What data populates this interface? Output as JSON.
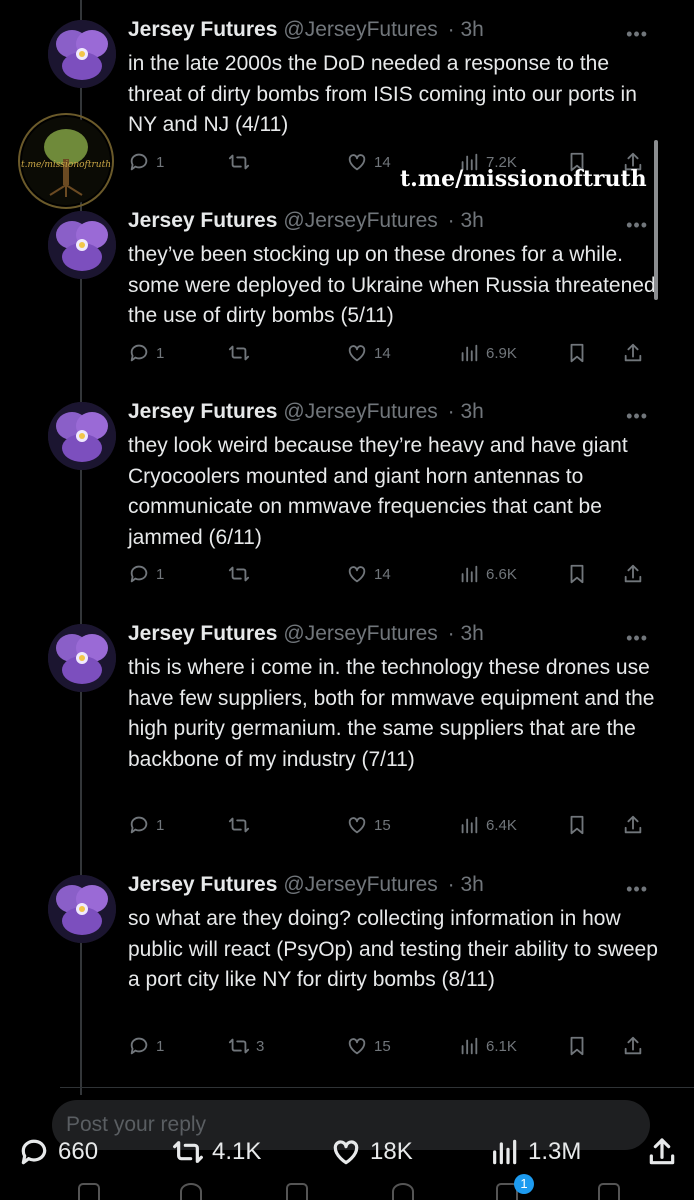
{
  "author": {
    "name": "Jersey Futures",
    "handle": "@JerseyFutures",
    "time": "· 3h"
  },
  "more_label": "•••",
  "tweets": [
    {
      "text": "in the late 2000s the DoD needed a response to the threat of dirty bombs from ISIS coming into our ports in NY and NJ (4/11)",
      "replies": "1",
      "retweets": "",
      "likes": "14",
      "views": "7.2K"
    },
    {
      "text": "they’ve been stocking up on these drones for a while. some were deployed to Ukraine when Russia threatened the use of dirty bombs (5/11)",
      "replies": "1",
      "retweets": "",
      "likes": "14",
      "views": "6.9K"
    },
    {
      "text": "they look weird because they’re heavy and have giant Cryocoolers mounted and giant horn antennas to communicate on mmwave frequencies that cant be jammed (6/11)",
      "replies": "1",
      "retweets": "",
      "likes": "14",
      "views": "6.6K"
    },
    {
      "text": "this is where i come in. the technology these drones use have few suppliers, both for mmwave equipment and the high purity germanium. the same suppliers that are the backbone of my industry (7/11)",
      "replies": "1",
      "retweets": "",
      "likes": "15",
      "views": "6.4K"
    },
    {
      "text": "so what are they doing? collecting information in how public will react (PsyOp) and testing their ability to sweep a port city like NY for dirty bombs (8/11)",
      "replies": "1",
      "retweets": "3",
      "likes": "15",
      "views": "6.1K"
    }
  ],
  "watermark": {
    "logo_text": "t.me/missionoftruth",
    "text": "t.me/missionoftruth"
  },
  "reply_placeholder": "Post your reply",
  "bottom_stats": {
    "replies": "660",
    "retweets": "4.1K",
    "likes": "18K",
    "views": "1.3M"
  },
  "notification_count": "1",
  "colors": {
    "background": "#000000",
    "text": "#e7e9ea",
    "muted": "#71767b",
    "accent": "#1d9bf0"
  }
}
